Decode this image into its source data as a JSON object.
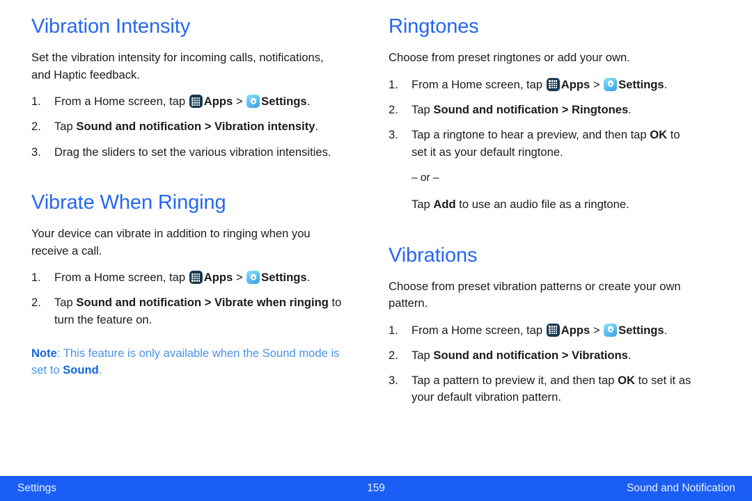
{
  "colors": {
    "heading": "#2567f0",
    "body_text": "#1b1b1b",
    "note_text": "#4a92ea",
    "note_label": "#1565e0",
    "footer_bg": "#1a5ef5",
    "footer_text": "#eaf1ff",
    "apps_icon_bg": "#17394f",
    "settings_icon_bg": "#5ec6f0"
  },
  "icons": {
    "apps": "apps-grid-icon",
    "settings": "settings-gear-icon"
  },
  "left_column": {
    "section1": {
      "heading": "Vibration Intensity",
      "intro": "Set the vibration intensity for incoming calls, notifications, and Haptic feedback.",
      "steps": [
        {
          "num": "1.",
          "parts": [
            {
              "t": "text",
              "v": "From a Home screen, tap "
            },
            {
              "t": "icon",
              "v": "apps"
            },
            {
              "t": "bold",
              "v": "Apps"
            },
            {
              "t": "text",
              "v": " > "
            },
            {
              "t": "icon",
              "v": "settings"
            },
            {
              "t": "bold",
              "v": "Settings"
            },
            {
              "t": "text",
              "v": "."
            }
          ]
        },
        {
          "num": "2.",
          "parts": [
            {
              "t": "text",
              "v": "Tap "
            },
            {
              "t": "bold",
              "v": "Sound and notification"
            },
            {
              "t": "bold",
              "v": " > "
            },
            {
              "t": "bold",
              "v": "Vibration intensity"
            },
            {
              "t": "text",
              "v": "."
            }
          ]
        },
        {
          "num": "3.",
          "parts": [
            {
              "t": "text",
              "v": "Drag the sliders to set the various vibration intensities."
            }
          ]
        }
      ]
    },
    "section2": {
      "heading": "Vibrate When Ringing",
      "intro": "Your device can vibrate in addition to ringing when you receive a call.",
      "steps": [
        {
          "num": "1.",
          "parts": [
            {
              "t": "text",
              "v": "From a Home screen, tap "
            },
            {
              "t": "icon",
              "v": "apps"
            },
            {
              "t": "bold",
              "v": "Apps"
            },
            {
              "t": "text",
              "v": " > "
            },
            {
              "t": "icon",
              "v": "settings"
            },
            {
              "t": "bold",
              "v": "Settings"
            },
            {
              "t": "text",
              "v": "."
            }
          ]
        },
        {
          "num": "2.",
          "parts": [
            {
              "t": "text",
              "v": "Tap "
            },
            {
              "t": "bold",
              "v": "Sound and notification"
            },
            {
              "t": "bold",
              "v": " > "
            },
            {
              "t": "bold",
              "v": "Vibrate when ringing"
            },
            {
              "t": "text",
              "v": " to turn the feature on."
            }
          ]
        }
      ],
      "note": {
        "label": "Note",
        "separator": ": ",
        "text_before": "This feature is only available when the Sound mode is set to ",
        "emphasis": "Sound",
        "text_after": "."
      }
    }
  },
  "right_column": {
    "section1": {
      "heading": "Ringtones",
      "intro": "Choose from preset ringtones or add your own.",
      "steps": [
        {
          "num": "1.",
          "parts": [
            {
              "t": "text",
              "v": "From a Home screen, tap "
            },
            {
              "t": "icon",
              "v": "apps"
            },
            {
              "t": "bold",
              "v": "Apps"
            },
            {
              "t": "text",
              "v": " > "
            },
            {
              "t": "icon",
              "v": "settings"
            },
            {
              "t": "bold",
              "v": "Settings"
            },
            {
              "t": "text",
              "v": "."
            }
          ]
        },
        {
          "num": "2.",
          "parts": [
            {
              "t": "text",
              "v": "Tap "
            },
            {
              "t": "bold",
              "v": "Sound and notification"
            },
            {
              "t": "bold",
              "v": " > "
            },
            {
              "t": "bold",
              "v": "Ringtones"
            },
            {
              "t": "text",
              "v": "."
            }
          ]
        },
        {
          "num": "3.",
          "parts": [
            {
              "t": "text",
              "v": "Tap a ringtone to hear a preview, and then tap "
            },
            {
              "t": "bold",
              "v": "OK"
            },
            {
              "t": "text",
              "v": " to set it as your default ringtone."
            }
          ]
        }
      ],
      "or_line": "– or –",
      "alt": {
        "text_before": "Tap ",
        "emphasis": "Add",
        "text_after": " to use an audio file as a ringtone."
      }
    },
    "section2": {
      "heading": "Vibrations",
      "intro": "Choose from preset vibration patterns or create your own pattern.",
      "steps": [
        {
          "num": "1.",
          "parts": [
            {
              "t": "text",
              "v": "From a Home screen, tap "
            },
            {
              "t": "icon",
              "v": "apps"
            },
            {
              "t": "bold",
              "v": "Apps"
            },
            {
              "t": "text",
              "v": " > "
            },
            {
              "t": "icon",
              "v": "settings"
            },
            {
              "t": "bold",
              "v": "Settings"
            },
            {
              "t": "text",
              "v": "."
            }
          ]
        },
        {
          "num": "2.",
          "parts": [
            {
              "t": "text",
              "v": "Tap "
            },
            {
              "t": "bold",
              "v": "Sound and notification"
            },
            {
              "t": "bold",
              "v": " > "
            },
            {
              "t": "bold",
              "v": "Vibrations"
            },
            {
              "t": "text",
              "v": "."
            }
          ]
        },
        {
          "num": "3.",
          "parts": [
            {
              "t": "text",
              "v": "Tap a pattern to preview it, and then tap "
            },
            {
              "t": "bold",
              "v": "OK"
            },
            {
              "t": "text",
              "v": " to set it as your default vibration pattern."
            }
          ]
        }
      ]
    }
  },
  "footer": {
    "left": "Settings",
    "page_number": "159",
    "right": "Sound and Notification"
  }
}
